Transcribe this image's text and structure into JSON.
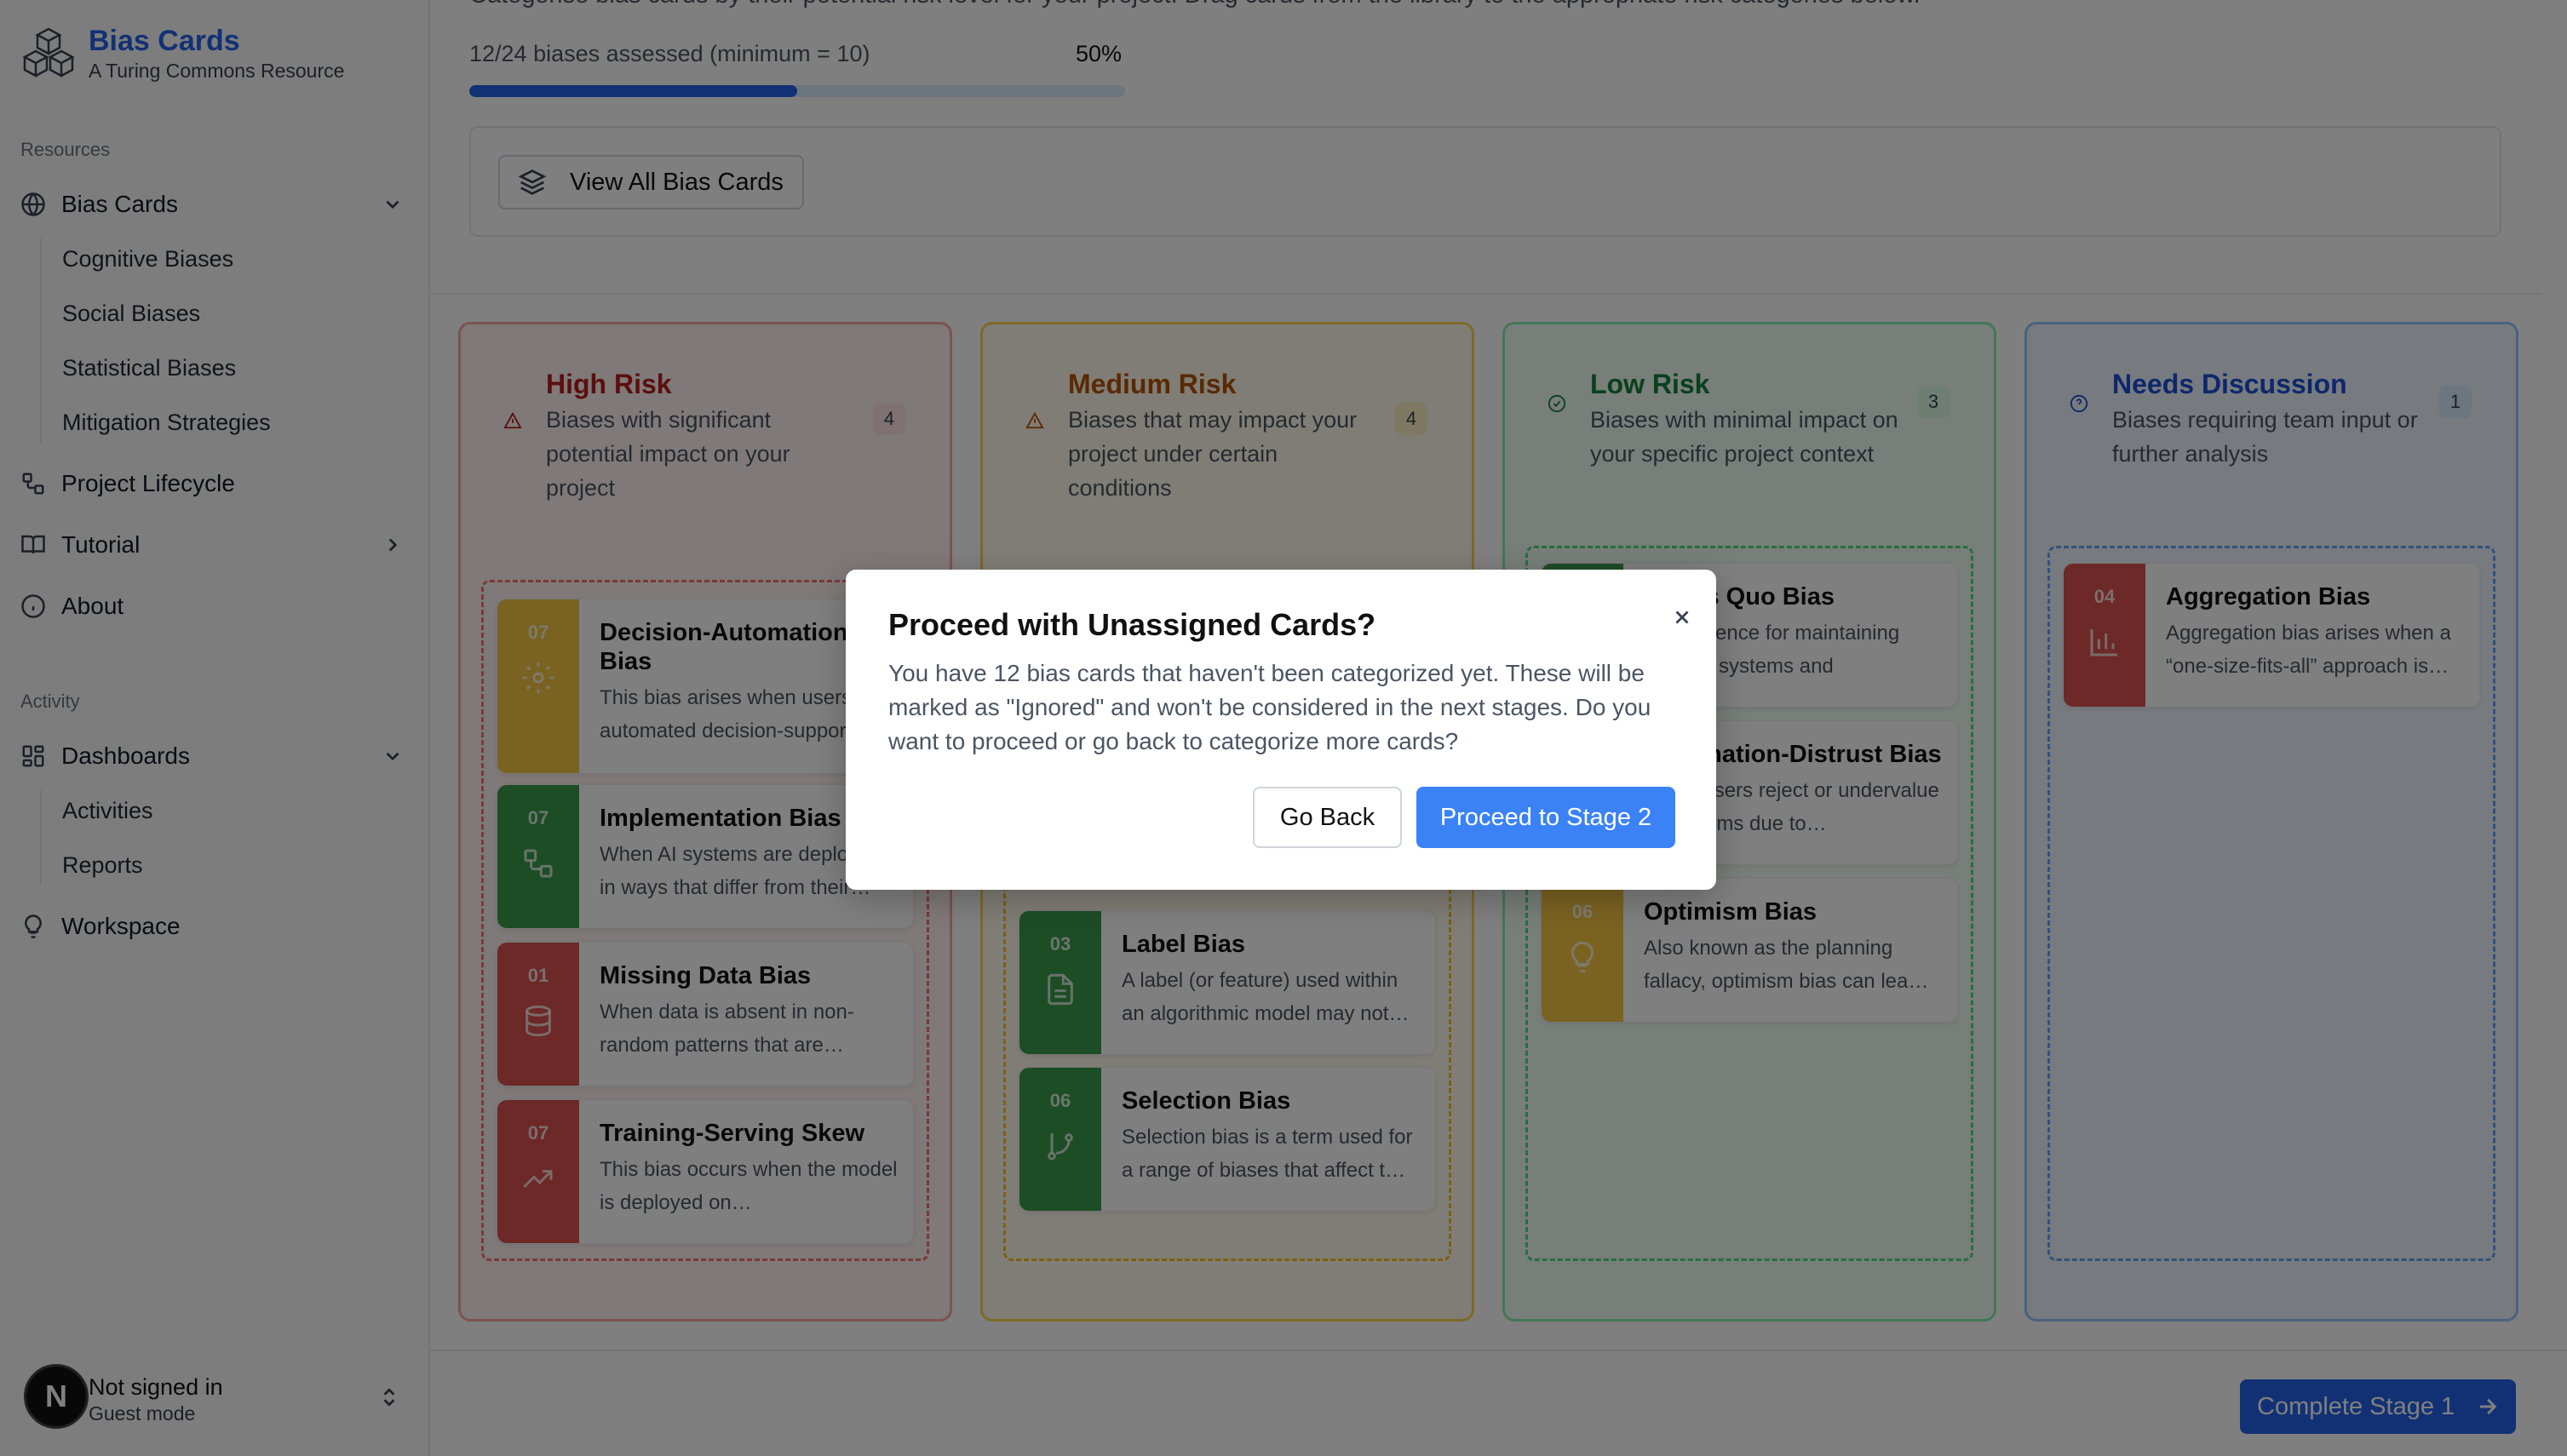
{
  "brand": {
    "title": "Bias Cards",
    "subtitle": "A Turing Commons Resource",
    "logo_icon": "cubes-icon"
  },
  "sidebar": {
    "resources_label": "Resources",
    "bias_cards": {
      "label": "Bias Cards",
      "icon": "globe-icon",
      "children": [
        "Cognitive Biases",
        "Social Biases",
        "Statistical Biases",
        "Mitigation Strategies"
      ]
    },
    "project_lifecycle": {
      "label": "Project Lifecycle",
      "icon": "workflow-icon"
    },
    "tutorial": {
      "label": "Tutorial",
      "icon": "book-icon"
    },
    "about": {
      "label": "About",
      "icon": "info-icon"
    },
    "activity_label": "Activity",
    "dashboards": {
      "label": "Dashboards",
      "icon": "grid-icon",
      "children": [
        "Activities",
        "Reports"
      ]
    },
    "workspace": {
      "label": "Workspace",
      "icon": "lightbulb-icon"
    }
  },
  "user": {
    "avatar_letter": "N",
    "name": "Not signed in",
    "mode": "Guest mode"
  },
  "main": {
    "intro": "Categorise bias cards by their potential risk level for your project. Drag cards from the library to the appropriate risk categories below.",
    "progress_label": "12/24 biases assessed (minimum = 10)",
    "progress_pct": "50%",
    "progress_value": 0.5,
    "view_all_label": "View All Bias Cards",
    "complete_label": "Complete Stage 1"
  },
  "columns": [
    {
      "title": "High Risk",
      "desc": "Biases with significant potential impact on your project",
      "count": "4",
      "color": "#b91c1c",
      "cards": [
        {
          "num": "07",
          "title": "Decision-Automation Bias",
          "desc": "This bias arises when users of automated decision-support",
          "strip": "#f4c542",
          "icon": "gear-icon"
        },
        {
          "num": "07",
          "title": "Implementation Bias",
          "desc": "When AI systems are deployed in ways that differ from their…",
          "strip": "#3b9a4a",
          "icon": "workflow-icon"
        },
        {
          "num": "01",
          "title": "Missing Data Bias",
          "desc": "When data is absent in non-random patterns that are…",
          "strip": "#d9534f",
          "icon": "database-icon"
        },
        {
          "num": "07",
          "title": "Training-Serving Skew",
          "desc": "This bias occurs when the model is deployed on…",
          "strip": "#d9534f",
          "icon": "trending-up-icon"
        }
      ]
    },
    {
      "title": "Medium Risk",
      "desc": "Biases that may impact your project under certain conditions",
      "count": "4",
      "color": "#b45309",
      "cards": [
        {
          "num": "03",
          "title": "Label Bias",
          "desc": "A label (or feature) used within an algorithmic model may not…",
          "strip": "#3b9a4a",
          "icon": "file-text-icon"
        },
        {
          "num": "06",
          "title": "Selection Bias",
          "desc": "Selection bias is a term used for a range of biases that affect t…",
          "strip": "#3b9a4a",
          "icon": "git-branch-icon"
        }
      ]
    },
    {
      "title": "Low Risk",
      "desc": "Biases with minimal impact on your specific project context",
      "count": "3",
      "color": "#15803d",
      "cards": [
        {
          "num": "",
          "title": "Status Quo Bias",
          "desc": "A preference for maintaining existing systems and processe…",
          "strip": "#3b9a4a",
          "icon": "none"
        },
        {
          "num": "",
          "title": "Automation-Distrust Bias",
          "desc": "When users reject or undervalue AI systems due to…",
          "strip": "#3b9a4a",
          "icon": "none"
        },
        {
          "num": "06",
          "title": "Optimism Bias",
          "desc": "Also known as the planning fallacy, optimism bias can lea…",
          "strip": "#f4c542",
          "icon": "lightbulb-icon"
        }
      ]
    },
    {
      "title": "Needs Discussion",
      "desc": "Biases requiring team input or further analysis",
      "count": "1",
      "color": "#1d4ed8",
      "cards": [
        {
          "num": "04",
          "title": "Aggregation Bias",
          "desc": "Aggregation bias arises when a “one-size-fits-all” approach is…",
          "strip": "#d9534f",
          "icon": "bar-chart-icon"
        }
      ]
    }
  ],
  "modal": {
    "title": "Proceed with Unassigned Cards?",
    "body": "You have 12 bias cards that haven't been categorized yet. These will be marked as \"Ignored\" and won't be considered in the next stages. Do you want to proceed or go back to categorize more cards?",
    "back_label": "Go Back",
    "proceed_label": "Proceed to Stage 2"
  }
}
